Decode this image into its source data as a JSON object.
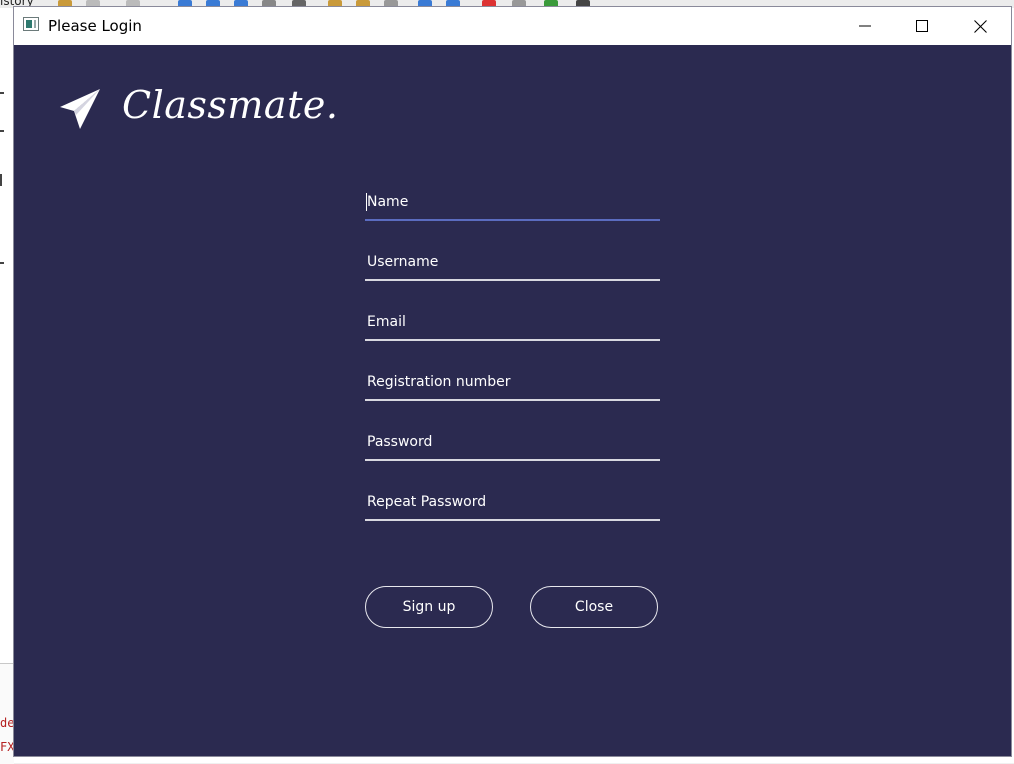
{
  "background": {
    "toolbar_text": "istory",
    "code_lines": [
      "de",
      "FX"
    ]
  },
  "window": {
    "title": "Please Login",
    "controls": {
      "minimize": "minimize-icon",
      "maximize": "maximize-icon",
      "close": "close-icon"
    },
    "background_color": "#2b2a50"
  },
  "logo": {
    "icon": "paper-plane-icon",
    "text": "Classmate."
  },
  "form": {
    "fields": [
      {
        "placeholder": "Name",
        "value": ""
      },
      {
        "placeholder": "Username",
        "value": ""
      },
      {
        "placeholder": "Email",
        "value": ""
      },
      {
        "placeholder": "Registration number",
        "value": ""
      },
      {
        "placeholder": "Password",
        "value": ""
      },
      {
        "placeholder": "Repeat Password",
        "value": ""
      }
    ],
    "signup_label": "Sign up",
    "close_label": "Close"
  }
}
